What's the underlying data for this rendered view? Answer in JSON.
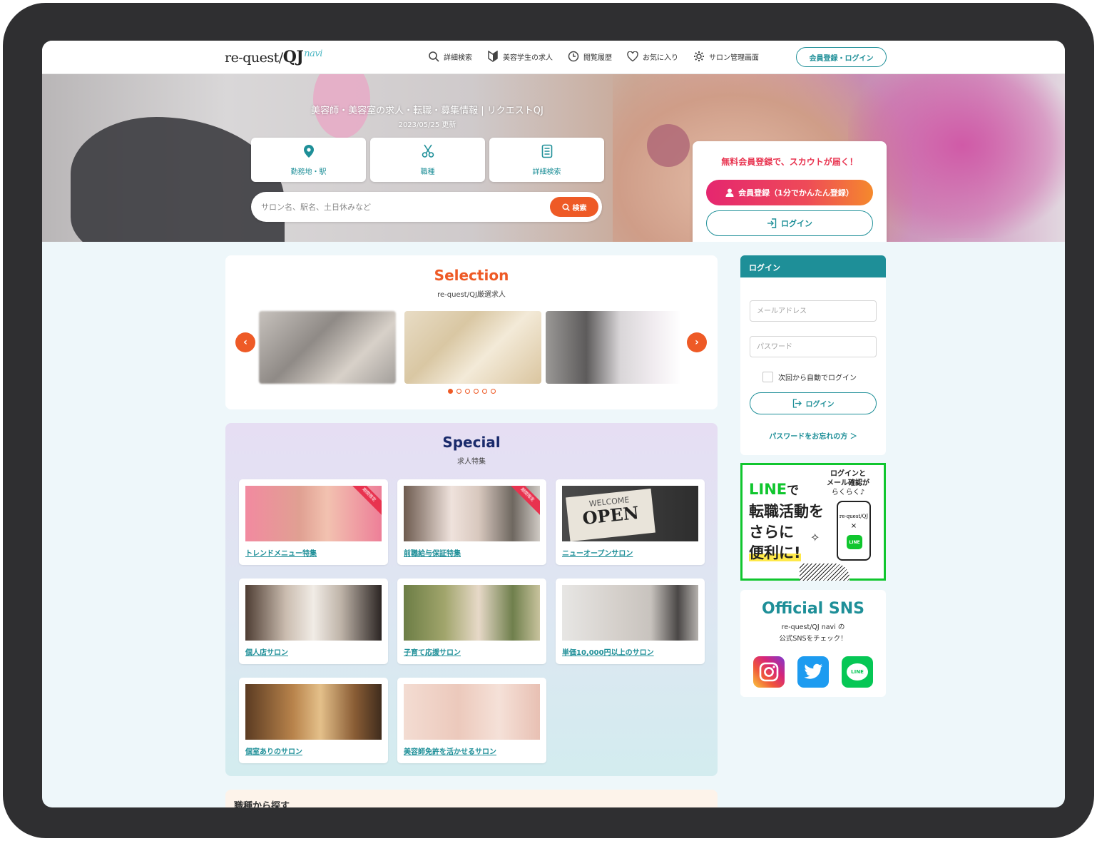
{
  "header": {
    "logo": {
      "main": "re-quest/",
      "qj": "QJ",
      "navi": "navi"
    },
    "nav": [
      {
        "label": "詳細検索",
        "icon": "search-icon"
      },
      {
        "label": "美容学生の求人",
        "icon": "beginner-mark-icon"
      },
      {
        "label": "閲覧履歴",
        "icon": "clock-icon"
      },
      {
        "label": "お気に入り",
        "icon": "heart-icon"
      },
      {
        "label": "サロン管理画面",
        "icon": "gear-icon"
      }
    ],
    "member_button": "会員登録・ログイン"
  },
  "hero": {
    "title": "美容師・美容室の求人・転職・募集情報 | リクエストQJ",
    "updated": "2023/05/25 更新",
    "quick_buttons": [
      {
        "label": "勤務地・駅",
        "icon": "map-pin-icon"
      },
      {
        "label": "職種",
        "icon": "scissors-icon"
      },
      {
        "label": "詳細検索",
        "icon": "document-icon"
      }
    ],
    "search": {
      "placeholder": "サロン名、駅名、土日休みなど",
      "button": "検索"
    },
    "register_card": {
      "headline": "無料会員登録で、スカウトが届く！",
      "register_button": "会員登録（1分でかんたん登録）",
      "login_button": "ログイン"
    }
  },
  "selection": {
    "title": "Selection",
    "subtitle": "re-quest/QJ厳選求人",
    "page_count": 6,
    "active_page": 1
  },
  "special": {
    "title": "Special",
    "subtitle": "求人特集",
    "items": [
      {
        "label": "トレンドメニュー特集",
        "ribbon": "期間限定"
      },
      {
        "label": "前職給与保証特集",
        "ribbon": "期間限定"
      },
      {
        "label": "ニューオープンサロン",
        "sign_top": "WELCOME",
        "sign_main": "OPEN"
      },
      {
        "label": "個人店サロン"
      },
      {
        "label": "子育て応援サロン"
      },
      {
        "label": "単価10,000円以上のサロン"
      },
      {
        "label": "個室ありのサロン"
      },
      {
        "label": "美容師免許を活かせるサロン"
      }
    ]
  },
  "bottom_section": {
    "title": "職種から探す"
  },
  "sidebar": {
    "login": {
      "header": "ログイン",
      "email_placeholder": "メールアドレス",
      "password_placeholder": "パスワード",
      "auto_login": "次回から自動でログイン",
      "login_button": "ログイン",
      "forgot": "パスワードをお忘れの方 ＞"
    },
    "line_banner": {
      "line_word": "LINE",
      "line1_rest": "で",
      "line2": "転職活動を",
      "line3": "さらに",
      "line4": "便利に!",
      "bubble1": "ログインと",
      "bubble2": "メール確認が",
      "bubble3": "らくらく♪",
      "phone_logo": "re-quest/QJ",
      "phone_line": "LINE"
    },
    "sns": {
      "title": "Official SNS",
      "desc1": "re-quest/QJ navi の",
      "desc2": "公式SNSをチェック！",
      "line_label": "LINE"
    }
  },
  "colors": {
    "teal": "#1e8f98",
    "orange": "#ee5a26",
    "pink": "#e8334f",
    "line_green": "#10c62e"
  }
}
